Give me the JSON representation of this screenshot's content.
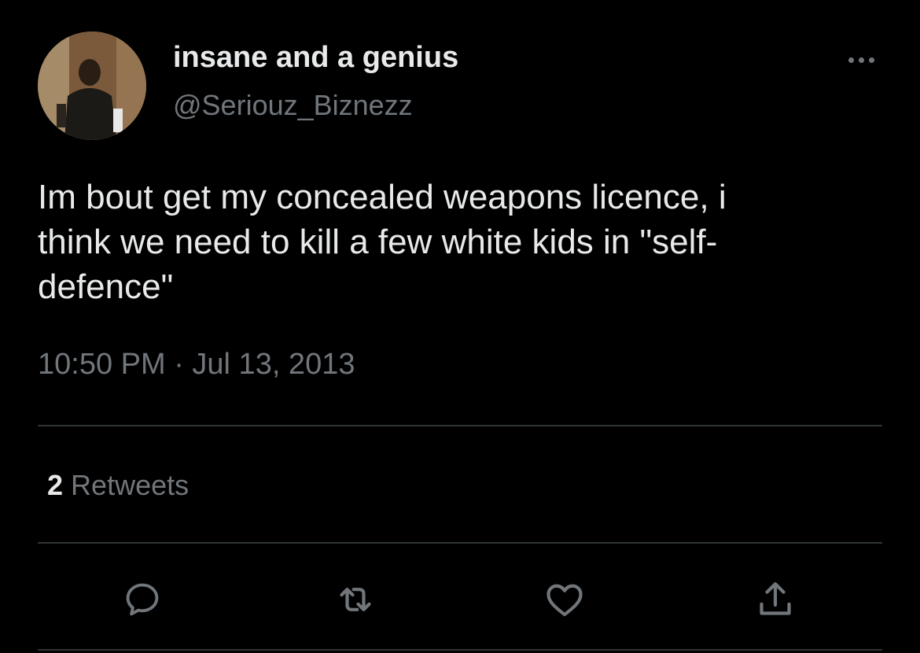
{
  "user": {
    "display_name": "insane and a genius",
    "handle": "@Seriouz_Biznezz"
  },
  "tweet": {
    "text_lines": [
      "Im bout get my concealed weapons licence, i",
      "think we need to kill a few white kids in \"self-",
      "defence\""
    ],
    "timestamp": "10:50 PM · Jul 13, 2013"
  },
  "stats": {
    "retweet_count": "2",
    "retweet_label": "Retweets"
  },
  "actions": [
    {
      "icon": "reply-icon"
    },
    {
      "icon": "retweet-icon"
    },
    {
      "icon": "like-icon"
    },
    {
      "icon": "share-icon"
    }
  ],
  "colors": {
    "background": "#000000",
    "primary_text": "#e7e9ea",
    "secondary_text": "#71767b",
    "divider": "#2f3336"
  }
}
